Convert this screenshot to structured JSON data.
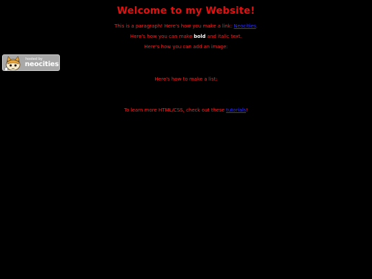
{
  "page": {
    "title": "Welcome to my Website!",
    "para_link": {
      "before": "This is a paragraph! Here's how you make a link: ",
      "link_text": "Neocities",
      "after": "."
    },
    "para_bold": {
      "before": "Here's how you can make ",
      "bold_text": "bold",
      "after": " and italic text."
    },
    "para_image": "Here's how you can add an image:",
    "para_list": "Here's how to make a list:",
    "para_learn": {
      "before": "To learn more HTML/CSS, check out these ",
      "link_text": "tutorials",
      "after": "!"
    }
  },
  "badge": {
    "small_text": "hosted by",
    "big_text": "neocities",
    "icon": "neocities-cat-icon"
  },
  "colors": {
    "background": "#000000",
    "text": "#ff2020",
    "title": "#e31010",
    "link": "#3030ff"
  }
}
